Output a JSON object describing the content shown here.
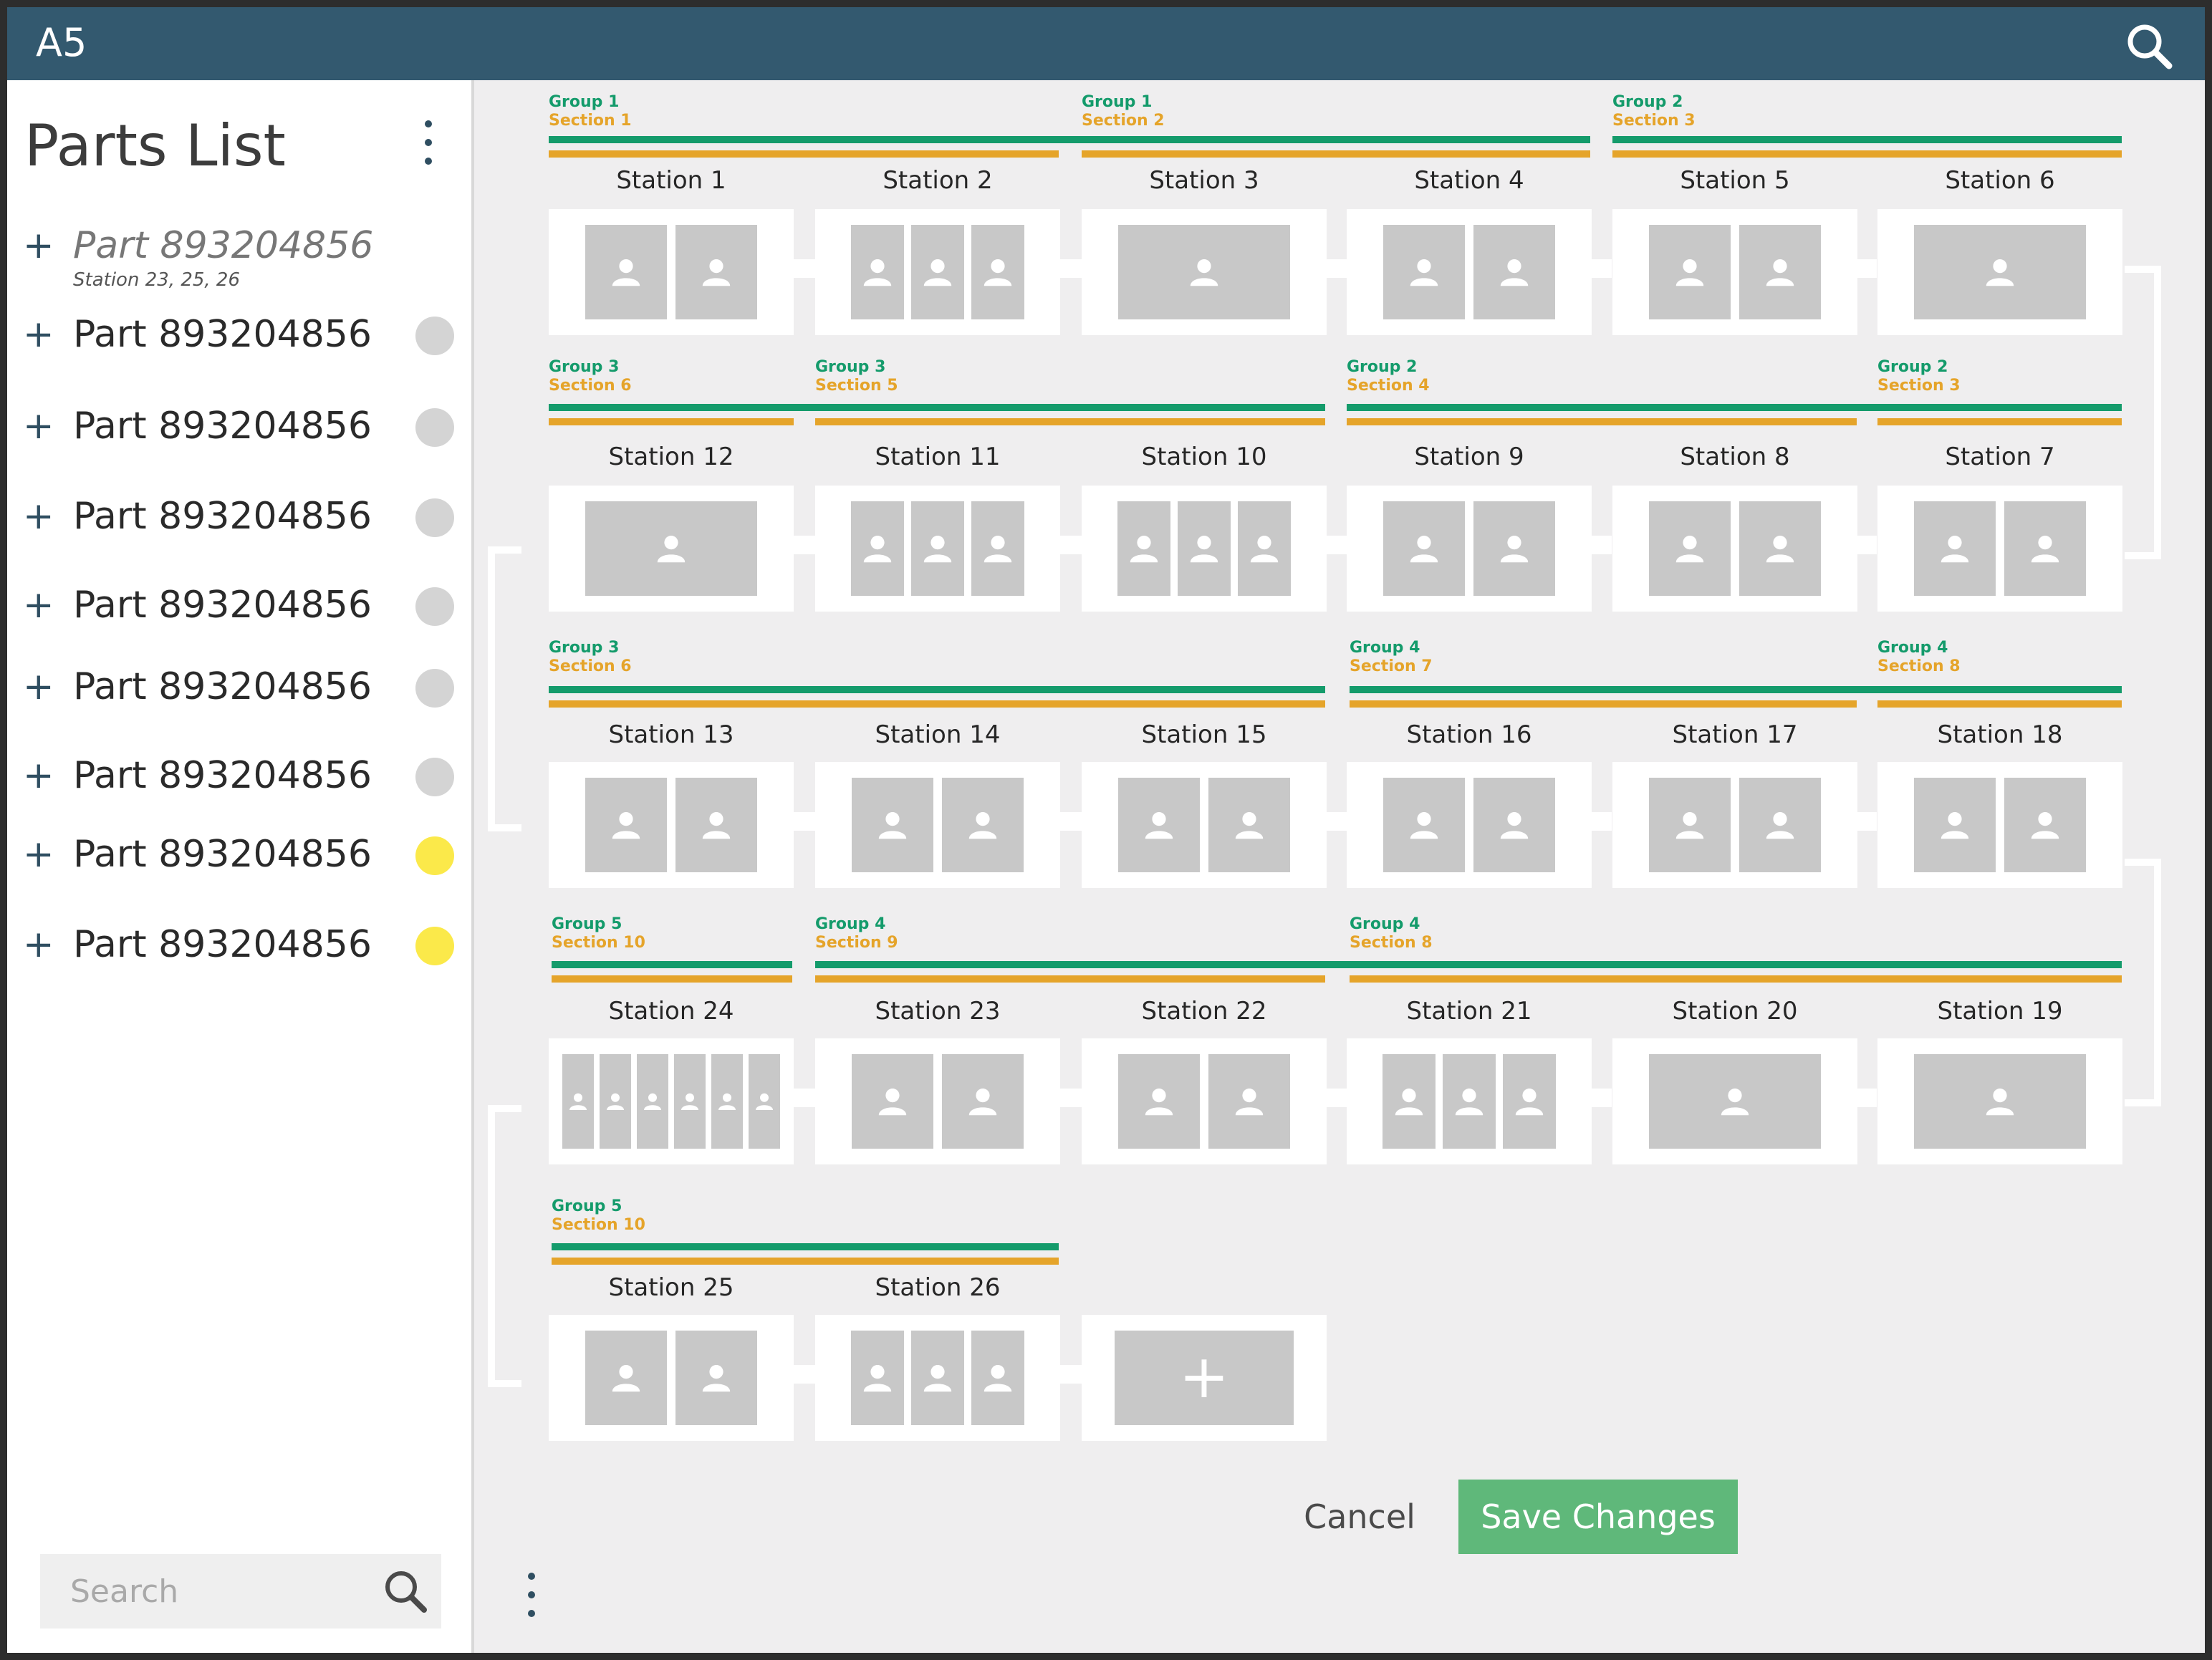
{
  "app": {
    "title": "A5"
  },
  "sidebar": {
    "title": "Parts List",
    "first_part": {
      "label": "Part 893204856",
      "stations": "Station 23, 25, 26"
    },
    "parts": [
      {
        "label": "Part 893204856",
        "status": "gray"
      },
      {
        "label": "Part 893204856",
        "status": "gray"
      },
      {
        "label": "Part 893204856",
        "status": "gray"
      },
      {
        "label": "Part 893204856",
        "status": "gray"
      },
      {
        "label": "Part 893204856",
        "status": "gray"
      },
      {
        "label": "Part 893204856",
        "status": "gray"
      },
      {
        "label": "Part 893204856",
        "status": "yellow"
      },
      {
        "label": "Part 893204856",
        "status": "yellow"
      }
    ],
    "search_placeholder": "Search"
  },
  "groups": [
    {
      "group": "Group 1",
      "section": "Section 1"
    },
    {
      "group": "Group 1",
      "section": "Section 2"
    },
    {
      "group": "Group 2",
      "section": "Section 3"
    },
    {
      "group": "Group 3",
      "section": "Section 6"
    },
    {
      "group": "Group 3",
      "section": "Section 5"
    },
    {
      "group": "Group 2",
      "section": "Section 4"
    },
    {
      "group": "Group 2",
      "section": "Section 3"
    },
    {
      "group": "Group 3",
      "section": "Section 6"
    },
    {
      "group": "Group 4",
      "section": "Section 7"
    },
    {
      "group": "Group 4",
      "section": "Section 8"
    },
    {
      "group": "Group 5",
      "section": "Section 10"
    },
    {
      "group": "Group 4",
      "section": "Section 9"
    },
    {
      "group": "Group 4",
      "section": "Section 8"
    },
    {
      "group": "Group 5",
      "section": "Section 10"
    }
  ],
  "stations": [
    {
      "name": "Station 1",
      "operators": 2
    },
    {
      "name": "Station 2",
      "operators": 3
    },
    {
      "name": "Station 3",
      "operators": 1
    },
    {
      "name": "Station 4",
      "operators": 2
    },
    {
      "name": "Station 5",
      "operators": 2
    },
    {
      "name": "Station 6",
      "operators": 1
    },
    {
      "name": "Station 12",
      "operators": 1
    },
    {
      "name": "Station 11",
      "operators": 3
    },
    {
      "name": "Station 10",
      "operators": 3
    },
    {
      "name": "Station 9",
      "operators": 2
    },
    {
      "name": "Station 8",
      "operators": 2
    },
    {
      "name": "Station 7",
      "operators": 2
    },
    {
      "name": "Station 13",
      "operators": 2
    },
    {
      "name": "Station 14",
      "operators": 2
    },
    {
      "name": "Station 15",
      "operators": 2
    },
    {
      "name": "Station 16",
      "operators": 2
    },
    {
      "name": "Station 17",
      "operators": 2
    },
    {
      "name": "Station 18",
      "operators": 2
    },
    {
      "name": "Station 24",
      "operators": 6
    },
    {
      "name": "Station 23",
      "operators": 2
    },
    {
      "name": "Station 22",
      "operators": 2
    },
    {
      "name": "Station 21",
      "operators": 3
    },
    {
      "name": "Station 20",
      "operators": 1
    },
    {
      "name": "Station 19",
      "operators": 1
    },
    {
      "name": "Station 25",
      "operators": 2
    },
    {
      "name": "Station 26",
      "operators": 3
    }
  ],
  "add_station": {
    "icon": "plus-icon",
    "label": "+"
  },
  "footer": {
    "cancel_label": "Cancel",
    "save_label": "Save Changes"
  },
  "colors": {
    "header": "#33596f",
    "group": "#149b6b",
    "section": "#e5a42a",
    "save": "#5fb87a",
    "status_yellow": "#fbe94a",
    "status_gray": "#d4d4d4"
  }
}
